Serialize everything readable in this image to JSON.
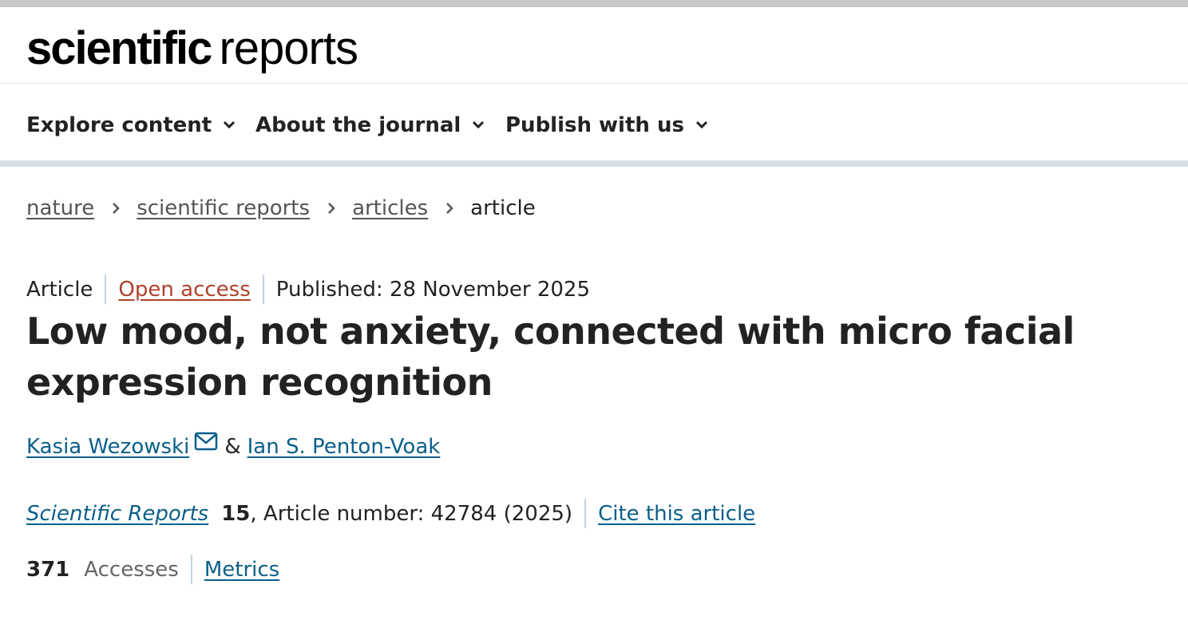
{
  "brand": {
    "logo_bold": "scientific",
    "logo_light": "reports"
  },
  "nav": {
    "items": [
      {
        "label": "Explore content"
      },
      {
        "label": "About the journal"
      },
      {
        "label": "Publish with us"
      }
    ]
  },
  "breadcrumb": {
    "items": [
      "nature",
      "scientific reports",
      "articles"
    ],
    "current": "article"
  },
  "article": {
    "type": "Article",
    "access": "Open access",
    "published": "Published: 28 November 2025",
    "title": "Low mood, not anxiety, connected with micro facial expression recognition",
    "authors": [
      "Kasia Wezowski",
      "Ian S. Penton-Voak"
    ],
    "author_separator": "&",
    "journal": "Scientific Reports",
    "volume": "15",
    "article_number": ", Article number: 42784 (2025)",
    "cite_label": "Cite this article",
    "accesses_count": "371",
    "accesses_label": "Accesses",
    "metrics_label": "Metrics"
  },
  "colors": {
    "link": "#0b5f8a",
    "open_access": "#b0412b",
    "separator": "#c5d3dc",
    "nav_rule": "#d5dfe5"
  }
}
